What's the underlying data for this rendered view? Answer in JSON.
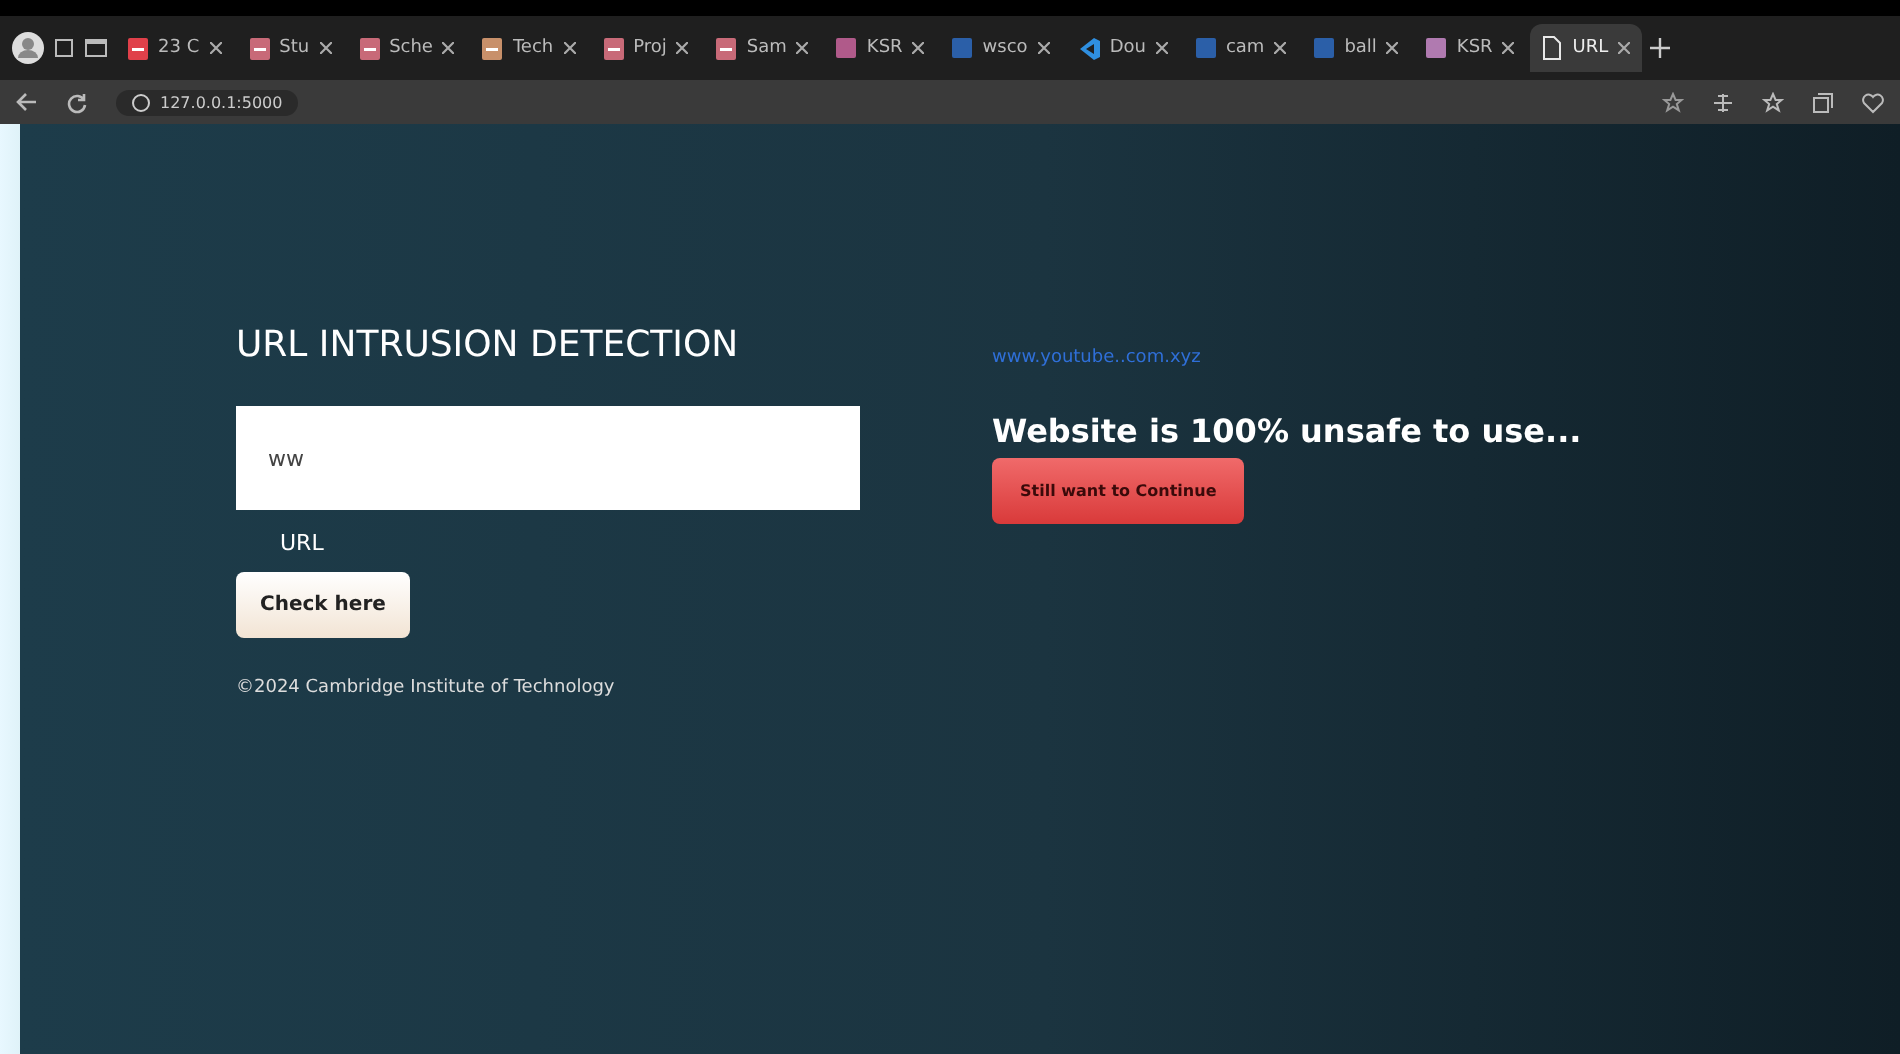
{
  "browser": {
    "tabs": [
      {
        "label": "23 C",
        "kind": "file",
        "color": "#e0404a",
        "selected": false
      },
      {
        "label": "Stu",
        "kind": "file",
        "color": "#c86a78",
        "selected": false
      },
      {
        "label": "Sche",
        "kind": "file",
        "color": "#c86a78",
        "selected": false
      },
      {
        "label": "Tech",
        "kind": "file",
        "color": "#c8906a",
        "selected": false
      },
      {
        "label": "Proj",
        "kind": "file",
        "color": "#c86a78",
        "selected": false
      },
      {
        "label": "Sam",
        "kind": "file",
        "color": "#c86a78",
        "selected": false
      },
      {
        "label": "KSR",
        "kind": "square",
        "color": "#b05a8a",
        "selected": false
      },
      {
        "label": "wsco",
        "kind": "square",
        "color": "#2b5fa8",
        "selected": false
      },
      {
        "label": "Dou",
        "kind": "code",
        "color": "#2f8fe0",
        "selected": false
      },
      {
        "label": "cam",
        "kind": "square",
        "color": "#2b5fa8",
        "selected": false
      },
      {
        "label": "ball",
        "kind": "square",
        "color": "#2b5fa8",
        "selected": false
      },
      {
        "label": "KSR",
        "kind": "square",
        "color": "#b07ab0",
        "selected": false
      },
      {
        "label": "URL",
        "kind": "page",
        "color": "#e8e8e8",
        "selected": true
      }
    ],
    "address": "127.0.0.1:5000"
  },
  "page": {
    "title": "URL INTRUSION DETECTION",
    "url_field": {
      "value": "ww",
      "label": "URL"
    },
    "check_button": "Check here",
    "footer": "©2024 Cambridge Institute of Technology",
    "result_link": "www.youtube..com.xyz",
    "result_message": "Website is 100% unsafe to use...",
    "continue_button": "Still want to Continue"
  }
}
